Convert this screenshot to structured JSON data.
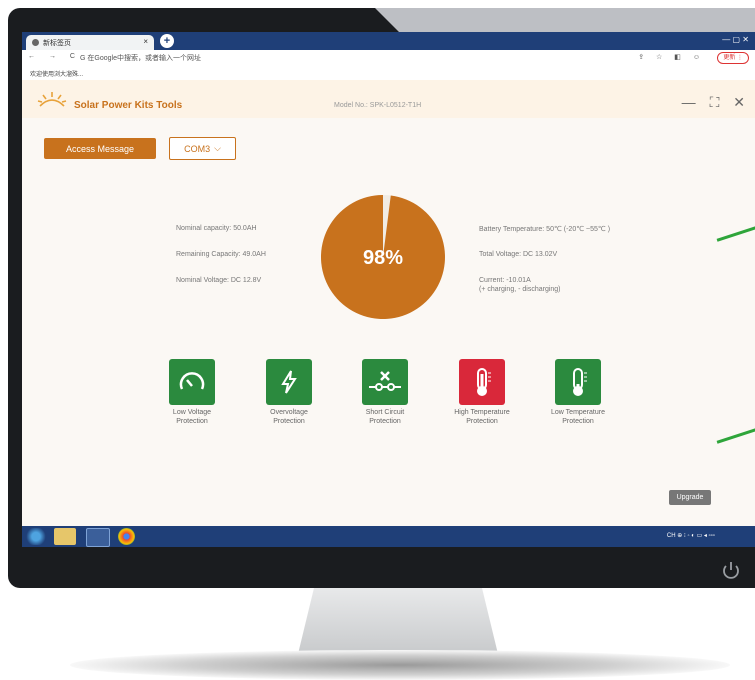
{
  "browser": {
    "tab_title": "新标签页",
    "tab_close": "×",
    "new_tab": "+",
    "window_controls": "— ▢ ✕",
    "nav": "← → C",
    "address_text": "G 在Google中搜索，或者输入一个网址",
    "toolbar_icons": "⇪ ☆ ◧ ☺",
    "update_label": "更新 ⋮",
    "bookmark": "欢迎使用浏大溜殊..."
  },
  "app": {
    "title": "Solar Power Kits Tools",
    "model": "Model No.: SPK-L0512-T1H",
    "controls": [
      "—",
      "⛶",
      "✕"
    ],
    "access_button": "Access Message",
    "port": "COM3"
  },
  "battery": {
    "left_stats": [
      "Nominal capacity: 50.0AH",
      "Remaining Capacity: 49.0AH",
      "Nominal Voltage: DC 12.8V"
    ],
    "right_stats": [
      "Battery Temperature: 50℃ (-20℃ ~55℃ )",
      "Total Voltage: DC 13.02V",
      "Current: -10.01A",
      "(+ charging, - discharging)"
    ],
    "percent_label": "98%",
    "percent": 98,
    "fill_color": "#c8721d"
  },
  "protections": [
    {
      "label1": "Low Voltage",
      "label2": "Protection",
      "icon": "gauge-icon",
      "color": "#2b8a3e"
    },
    {
      "label1": "Overvoltage",
      "label2": "Protection",
      "icon": "lightning-icon",
      "color": "#2b8a3e"
    },
    {
      "label1": "Short Circuit",
      "label2": "Protection",
      "icon": "short-circuit-icon",
      "color": "#2b8a3e"
    },
    {
      "label1": "High Temperature",
      "label2": "Protection",
      "icon": "thermometer-high-icon",
      "color": "#d9283a"
    },
    {
      "label1": "Low Temperature",
      "label2": "Protection",
      "icon": "thermometer-low-icon",
      "color": "#2b8a3e"
    }
  ],
  "upgrade_button": "Upgrade",
  "taskbar": {
    "tray_text": "CH ⊕ ⁝   ◦ ◐ ▭ ◂    ▫▫▫"
  }
}
